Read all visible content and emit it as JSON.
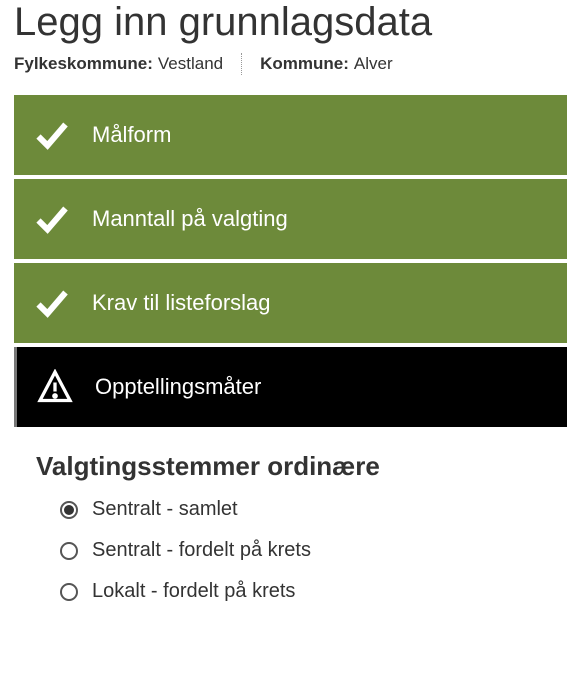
{
  "header": {
    "title": "Legg inn grunnlagsdata",
    "fylkeskommune_label": "Fylkeskommune:",
    "fylkeskommune_value": "Vestland",
    "kommune_label": "Kommune:",
    "kommune_value": "Alver"
  },
  "steps": {
    "malform": {
      "label": "Målform"
    },
    "manntall": {
      "label": "Manntall på valgting"
    },
    "listeforslag": {
      "label": "Krav til listeforslag"
    },
    "opptelling": {
      "label": "Opptellingsmåter"
    }
  },
  "content": {
    "section_heading": "Valgtingsstemmer ordinære",
    "options": {
      "sentralt_samlet": {
        "label": "Sentralt - samlet"
      },
      "sentralt_fordelt": {
        "label": "Sentralt - fordelt på krets"
      },
      "lokalt_fordelt": {
        "label": "Lokalt - fordelt på krets"
      }
    }
  }
}
